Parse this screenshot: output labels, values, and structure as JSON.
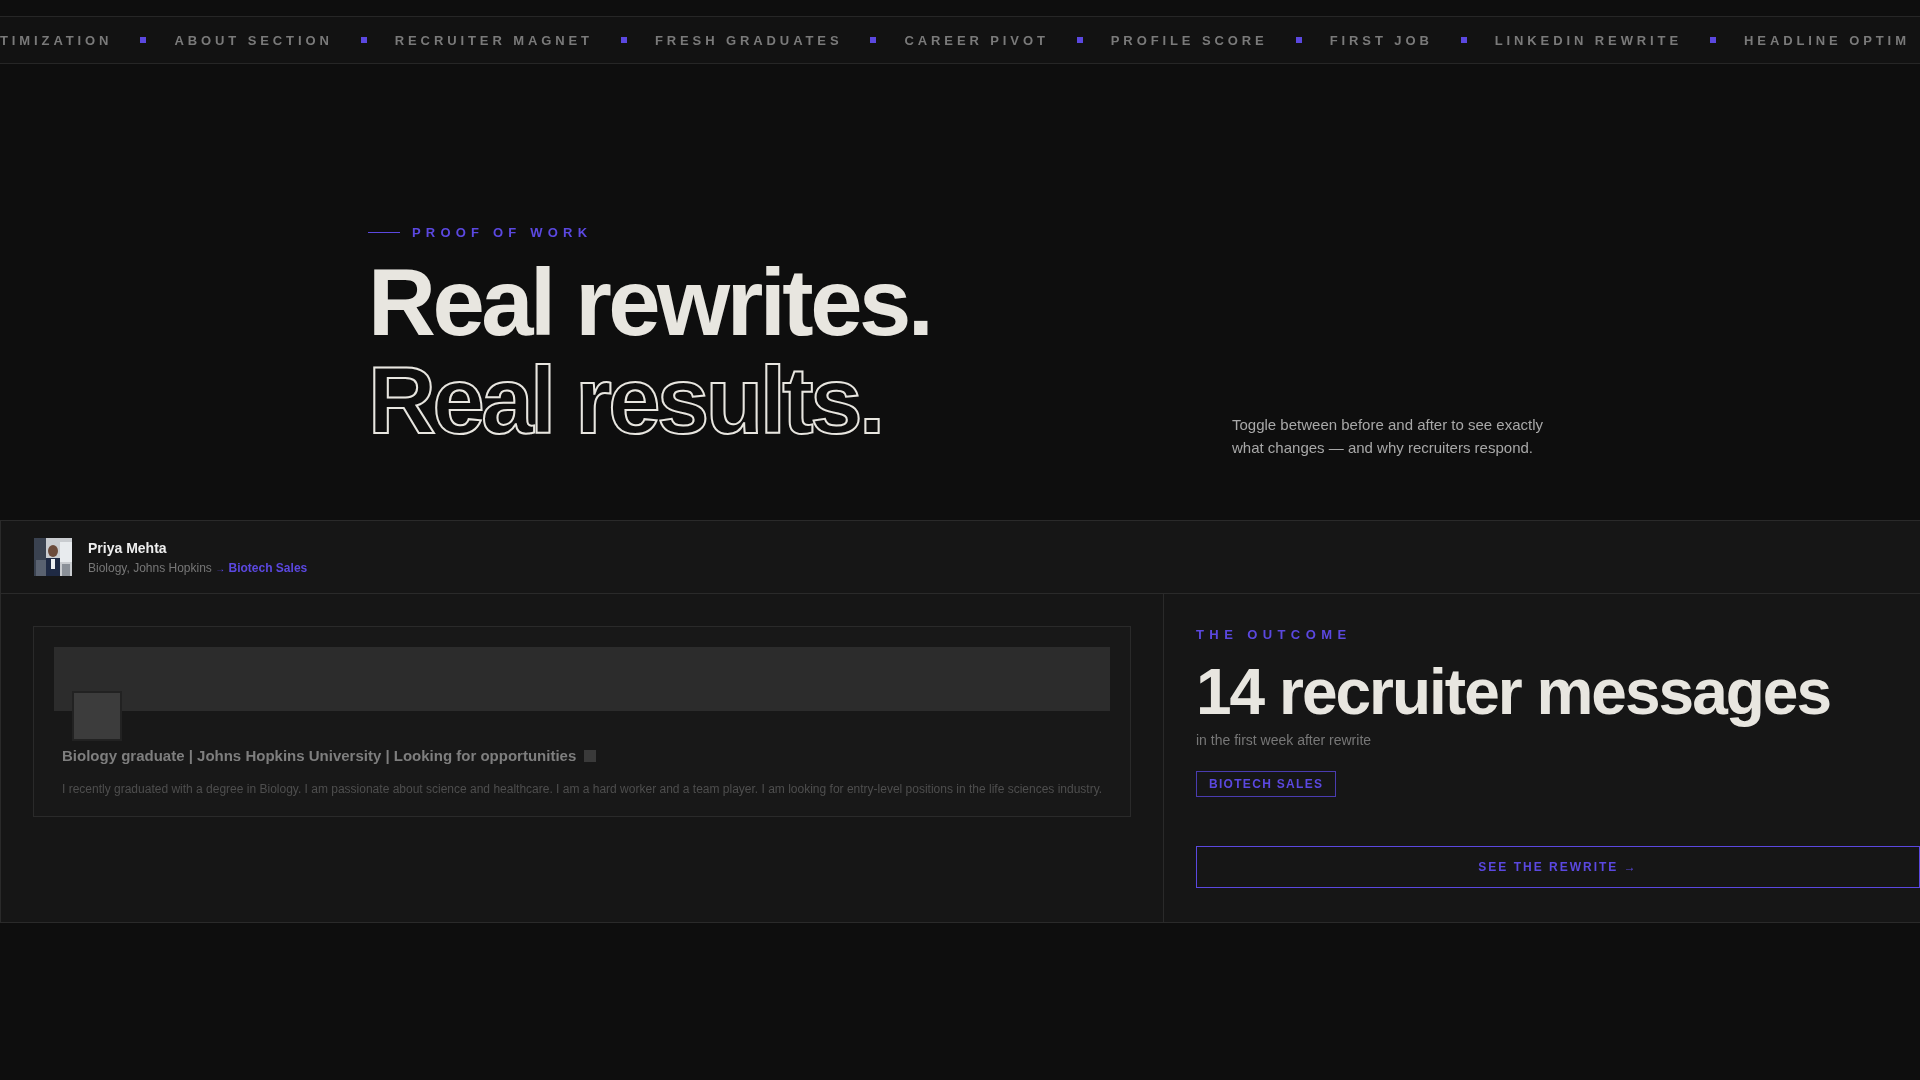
{
  "ticker": [
    "TIMIZATION",
    "ABOUT SECTION",
    "RECRUITER MAGNET",
    "FRESH GRADUATES",
    "CAREER PIVOT",
    "PROFILE SCORE",
    "FIRST JOB",
    "LINKEDIN REWRITE",
    "HEADLINE OPTIM"
  ],
  "hero": {
    "eyebrow": "PROOF OF WORK",
    "title_lines": [
      {
        "text": "Real rewrites.",
        "kind": "solid"
      },
      {
        "text": "Real results.",
        "kind": "outline"
      }
    ],
    "description": "Toggle between before and after to see exactly what changes — and why recruiters respond."
  },
  "profile": {
    "name": "Priya Mehta",
    "from": "Biology, Johns Hopkins",
    "arrow": "→",
    "to": "Biotech Sales"
  },
  "before_card": {
    "headline": "Biology graduate | Johns Hopkins University | Looking for opportunities",
    "summary": "I recently graduated with a degree in Biology. I am passionate about science and healthcare. I am a hard worker and a team player. I am looking for entry-level positions in the life sciences industry."
  },
  "outcome": {
    "eyebrow": "THE OUTCOME",
    "metric": "14 recruiter messages",
    "caption": "in the first week after rewrite",
    "tag": "BIOTECH SALES",
    "button": "SEE THE REWRITE",
    "button_arrow": "→"
  }
}
